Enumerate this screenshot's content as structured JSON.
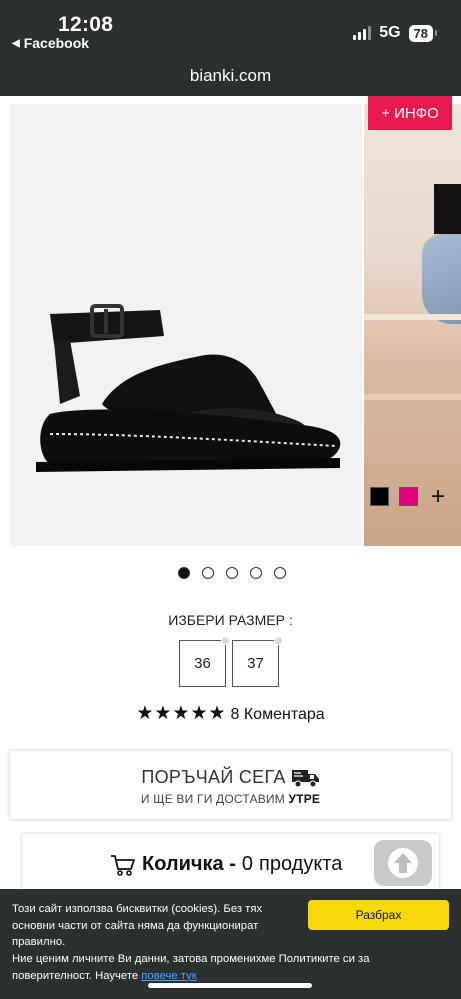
{
  "status_bar": {
    "time": "12:08",
    "back_label": "Facebook",
    "network": "5G",
    "battery": "78"
  },
  "browser": {
    "url": "bianki.com"
  },
  "gallery": {
    "info_button": "+ ИНФО",
    "slides_count": 5,
    "active_slide": 1,
    "swatches": [
      {
        "name": "black",
        "color": "#000000"
      },
      {
        "name": "pink",
        "color": "#e6007e"
      }
    ],
    "add_swatch_icon": "plus-icon"
  },
  "size_selector": {
    "label": "ИЗБЕРИ РАЗМЕР :",
    "sizes": [
      "36",
      "37"
    ]
  },
  "rating": {
    "stars": "★★★★★",
    "value": 5,
    "comments": "8 Коментара"
  },
  "order": {
    "title": "ПОРЪЧАЙ СЕГА",
    "subtitle_prefix": "И ЩЕ ВИ ГИ ДОСТАВИМ",
    "subtitle_bold": "УТРЕ",
    "icon": "truck-icon"
  },
  "cart": {
    "label": "Количка -",
    "count": "0",
    "unit": "продукта",
    "icon": "cart-icon"
  },
  "cookie_banner": {
    "text1": "Този сайт използва бисквитки (cookies). Без тях основни части от сайта няма да функционират правилно.",
    "text2": "Ние ценим личните Ви данни, затова променихме Политиките си за поверителност. Научете",
    "link": "повече тук",
    "accept": "Разбрах"
  }
}
